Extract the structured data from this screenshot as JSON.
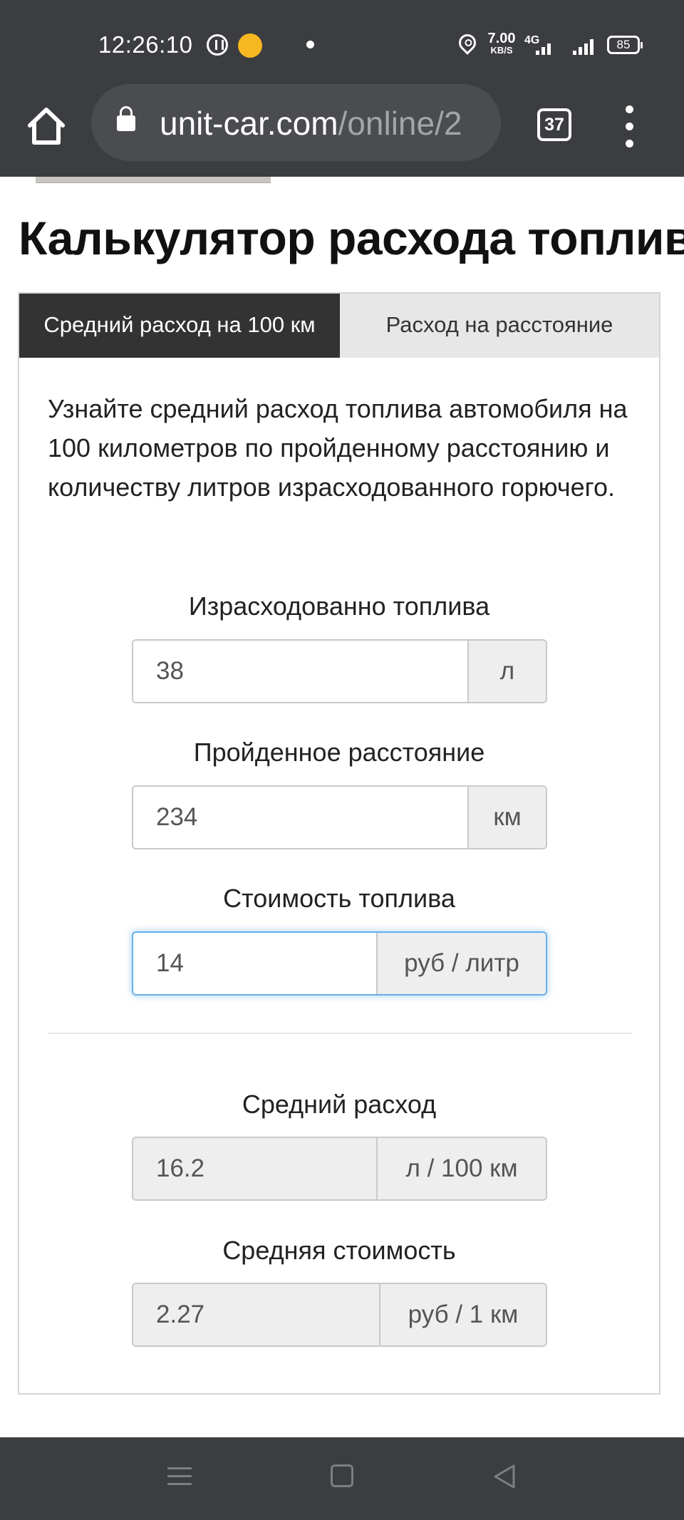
{
  "status_bar": {
    "time": "12:26:10",
    "speed_value": "7.00",
    "speed_unit": "KB/S",
    "network": "4G",
    "battery": "85"
  },
  "browser": {
    "url_host": "unit-car.com",
    "url_path": "/online/2",
    "tab_count": "37"
  },
  "page": {
    "title": "Калькулятор расхода топлива",
    "tabs": [
      {
        "label": "Средний расход на 100 км",
        "active": true
      },
      {
        "label": "Расход на расстояние",
        "active": false
      }
    ],
    "intro": "Узнайте средний расход топлива автомобиля на 100 километров по пройденному расстоянию и количеству литров израсходованного горючего.",
    "fields": [
      {
        "label": "Израсходованно топлива",
        "value": "38",
        "unit": "л"
      },
      {
        "label": "Пройденное расстояние",
        "value": "234",
        "unit": "км"
      },
      {
        "label": "Стоимость топлива",
        "value": "14",
        "unit": "руб / литр"
      }
    ],
    "results": [
      {
        "label": "Средний расход",
        "value": "16.2",
        "unit": "л / 100 км"
      },
      {
        "label": "Средняя стоимость",
        "value": "2.27",
        "unit": "руб / 1 км"
      }
    ]
  },
  "colors": {
    "chrome": "#3b3d40",
    "tab_active": "#333333",
    "focus": "#66afe9"
  }
}
